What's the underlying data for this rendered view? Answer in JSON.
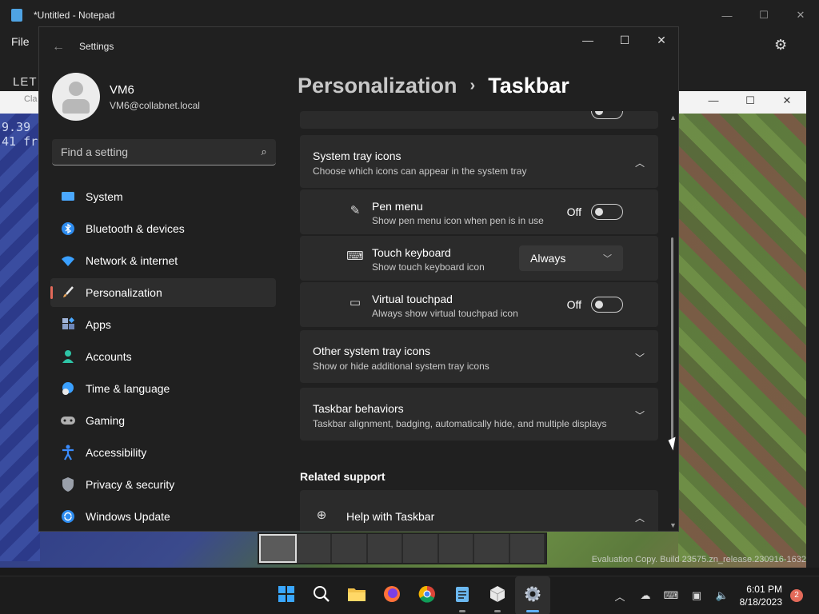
{
  "notepad": {
    "title": "*Untitled - Notepad",
    "menu_file": "File",
    "text_fragment": "LET"
  },
  "game": {
    "titlebar_label": "Cla",
    "stat_line1": "9.39",
    "stat_line2": "41 fr",
    "eval_text": "Evaluation Copy. Build 23575.zn_release.230916-1632"
  },
  "settings": {
    "title": "Settings",
    "profile": {
      "name": "VM6",
      "email": "VM6@collabnet.local"
    },
    "search": {
      "placeholder": "Find a setting"
    },
    "nav": [
      {
        "label": "System",
        "icon": "monitor-icon",
        "color": "#4aa8ff"
      },
      {
        "label": "Bluetooth & devices",
        "icon": "bluetooth-icon",
        "color": "#2d8cf0"
      },
      {
        "label": "Network & internet",
        "icon": "wifi-icon",
        "color": "#3aa0ff"
      },
      {
        "label": "Personalization",
        "icon": "brush-icon",
        "color": "#e6a35a"
      },
      {
        "label": "Apps",
        "icon": "apps-icon",
        "color": "#8aa0c8"
      },
      {
        "label": "Accounts",
        "icon": "person-icon",
        "color": "#2ec4a6"
      },
      {
        "label": "Time & language",
        "icon": "globe-clock-icon",
        "color": "#3aa0ff"
      },
      {
        "label": "Gaming",
        "icon": "gamepad-icon",
        "color": "#b0b0b0"
      },
      {
        "label": "Accessibility",
        "icon": "accessibility-icon",
        "color": "#3a8cff"
      },
      {
        "label": "Privacy & security",
        "icon": "shield-icon",
        "color": "#9aa0aa"
      },
      {
        "label": "Windows Update",
        "icon": "update-icon",
        "color": "#2d8cf0"
      }
    ],
    "breadcrumb": {
      "parent": "Personalization",
      "separator": "›",
      "current": "Taskbar"
    },
    "system_tray": {
      "title": "System tray icons",
      "subtitle": "Choose which icons can appear in the system tray",
      "rows": {
        "pen": {
          "title": "Pen menu",
          "subtitle": "Show pen menu icon when pen is in use",
          "state": "Off"
        },
        "keyboard": {
          "title": "Touch keyboard",
          "subtitle": "Show touch keyboard icon",
          "value": "Always"
        },
        "touchpad": {
          "title": "Virtual touchpad",
          "subtitle": "Always show virtual touchpad icon",
          "state": "Off"
        }
      }
    },
    "other_tray": {
      "title": "Other system tray icons",
      "subtitle": "Show or hide additional system tray icons"
    },
    "behaviors": {
      "title": "Taskbar behaviors",
      "subtitle": "Taskbar alignment, badging, automatically hide, and multiple displays"
    },
    "related": {
      "heading": "Related support",
      "help_title": "Help with Taskbar"
    }
  },
  "taskbar": {
    "clock_time": "6:01 PM",
    "clock_date": "8/18/2023",
    "notification_count": "2"
  }
}
